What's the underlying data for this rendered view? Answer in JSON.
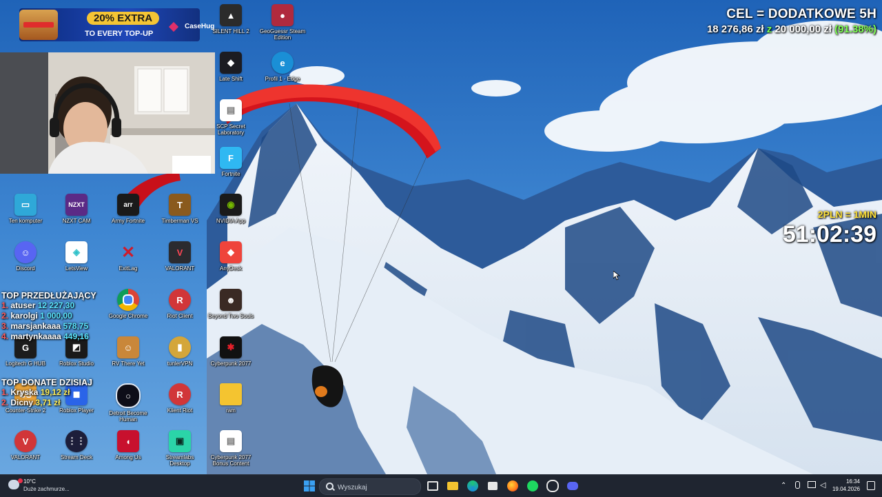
{
  "desktop": {
    "icons": [
      {
        "label": "SILENT HILL 2",
        "icon": "silent-hill-icon",
        "color": "#2b2b2b"
      },
      {
        "label": "GeoGuessr Steam Edition",
        "icon": "map-pin-icon",
        "color": "#b02a3e"
      },
      {
        "label": "Late Shift",
        "icon": "late-shift-icon",
        "color": "#1c1c22"
      },
      {
        "label": "Profil 1 - Edge",
        "icon": "edge-icon",
        "color": "#1a8fd6"
      },
      {
        "label": "SCP Secret Laboratory",
        "icon": "file-icon",
        "color": "#ffffff"
      },
      {
        "label": "Fortnite",
        "icon": "fortnite-icon",
        "color": "#2fb8f2"
      },
      {
        "label": "Ten komputer",
        "icon": "monitor-icon",
        "color": "#2fa8d8"
      },
      {
        "label": "NZXT CAM",
        "icon": "nzxt-icon",
        "color": "#5b2a86"
      },
      {
        "label": "Army Fortnite",
        "icon": "army-icon",
        "color": "#1a1a1a"
      },
      {
        "label": "Timberman VS",
        "icon": "timberman-icon",
        "color": "#8a5a1e"
      },
      {
        "label": "NVIDIA App",
        "icon": "nvidia-icon",
        "color": "#1a1a1a"
      },
      {
        "label": "Discord",
        "icon": "discord-icon",
        "color": "#5865f2"
      },
      {
        "label": "LetsView",
        "icon": "letsview-icon",
        "color": "#2fc1c9"
      },
      {
        "label": "ExitLag",
        "icon": "exitlag-icon",
        "color": "#cf1b2b"
      },
      {
        "label": "VALORANT",
        "icon": "valorant-icon",
        "color": "#2b2b2f"
      },
      {
        "label": "AnyDesk",
        "icon": "anydesk-icon",
        "color": "#ef443b"
      },
      {
        "label": "Google Chrome",
        "icon": "chrome-icon",
        "color": "#ffffff"
      },
      {
        "label": "Riot Client",
        "icon": "riot-icon",
        "color": "#d13639"
      },
      {
        "label": "Beyond Two Souls",
        "icon": "beyond-icon",
        "color": "#3a2a24"
      },
      {
        "label": "Logitech G HUB",
        "icon": "ghub-icon",
        "color": "#1c1c1c"
      },
      {
        "label": "Roblox Studio",
        "icon": "roblox-studio-icon",
        "color": "#1a1a1a"
      },
      {
        "label": "RV There Yet",
        "icon": "rv-icon",
        "color": "#c9873a"
      },
      {
        "label": "tunlerVPN",
        "icon": "vpn-icon",
        "color": "#d4a63a"
      },
      {
        "label": "Cyberpunk 2077",
        "icon": "cyberpunk-icon",
        "color": "#111111"
      },
      {
        "label": "Counter-Strike 2",
        "icon": "cs2-icon",
        "color": "#e8a23a"
      },
      {
        "label": "Roblox Player",
        "icon": "roblox-icon",
        "color": "#2a64e8"
      },
      {
        "label": "Detroit Become Human",
        "icon": "detroit-icon",
        "color": "#0d0d18"
      },
      {
        "label": "Klient Riot",
        "icon": "riot-icon",
        "color": "#d13639"
      },
      {
        "label": "ram",
        "icon": "folder-icon",
        "color": "#f4c430"
      },
      {
        "label": "VALORANT",
        "icon": "valorant-icon",
        "color": "#d13639"
      },
      {
        "label": "Stream Deck",
        "icon": "stream-deck-icon",
        "color": "#1d1e3a"
      },
      {
        "label": "Among Us",
        "icon": "among-us-icon",
        "color": "#c8102e"
      },
      {
        "label": "Streamlabs Desktop",
        "icon": "streamlabs-icon",
        "color": "#2bd4a8"
      },
      {
        "label": "Cyberpunk 2077 Bonus Content",
        "icon": "file-icon",
        "color": "#ffffff"
      }
    ]
  },
  "overlay": {
    "promo": {
      "badge": "20% EXTRA",
      "subtitle": "TO EVERY TOP-UP",
      "brand": "CaseHug"
    },
    "goal": {
      "title": "CEL = DODATKOWE 5H",
      "current": "18 276,86 zł",
      "separator": "z",
      "target": "20 000,00 zł",
      "percent": "(91.38%)"
    },
    "subathon": {
      "rate": "2PLN = 1MIN",
      "time": "51:02:39"
    },
    "top_extenders": {
      "title": "TOP PRZEDŁUŻAJĄCY",
      "rows": [
        {
          "rank": "1.",
          "name": "atuser",
          "amount": "12 227,30"
        },
        {
          "rank": "2.",
          "name": "karolgi",
          "amount": "1 000,00"
        },
        {
          "rank": "3.",
          "name": "marsjankaaa",
          "amount": "578,75"
        },
        {
          "rank": "4.",
          "name": "martynkaaaa",
          "amount": "449,16"
        }
      ]
    },
    "top_donations": {
      "title": "TOP DONATE DZISIAJ",
      "rows": [
        {
          "rank": "1.",
          "name": "Kryska",
          "amount": "19,12 zł"
        },
        {
          "rank": "2.",
          "name": "Dicny",
          "amount": "3,71 zł"
        }
      ]
    }
  },
  "taskbar": {
    "weather": {
      "temp": "10°C",
      "desc": "Duże zachmurze..."
    },
    "search_placeholder": "Wyszukaj",
    "clock": {
      "time": "16:34",
      "date": "19.04.2026"
    },
    "pinned": [
      {
        "name": "task-view-icon",
        "color": "#ffffff"
      },
      {
        "name": "file-explorer-icon",
        "color": "#f4c430"
      },
      {
        "name": "edge-icon",
        "color": "#1a8fd6"
      },
      {
        "name": "store-icon",
        "color": "#ffffff"
      },
      {
        "name": "firefox-icon",
        "color": "#ff7a1a"
      },
      {
        "name": "spotify-icon",
        "color": "#1ed760"
      },
      {
        "name": "obs-icon",
        "color": "#ffffff"
      },
      {
        "name": "discord-icon",
        "color": "#5865f2"
      }
    ]
  }
}
